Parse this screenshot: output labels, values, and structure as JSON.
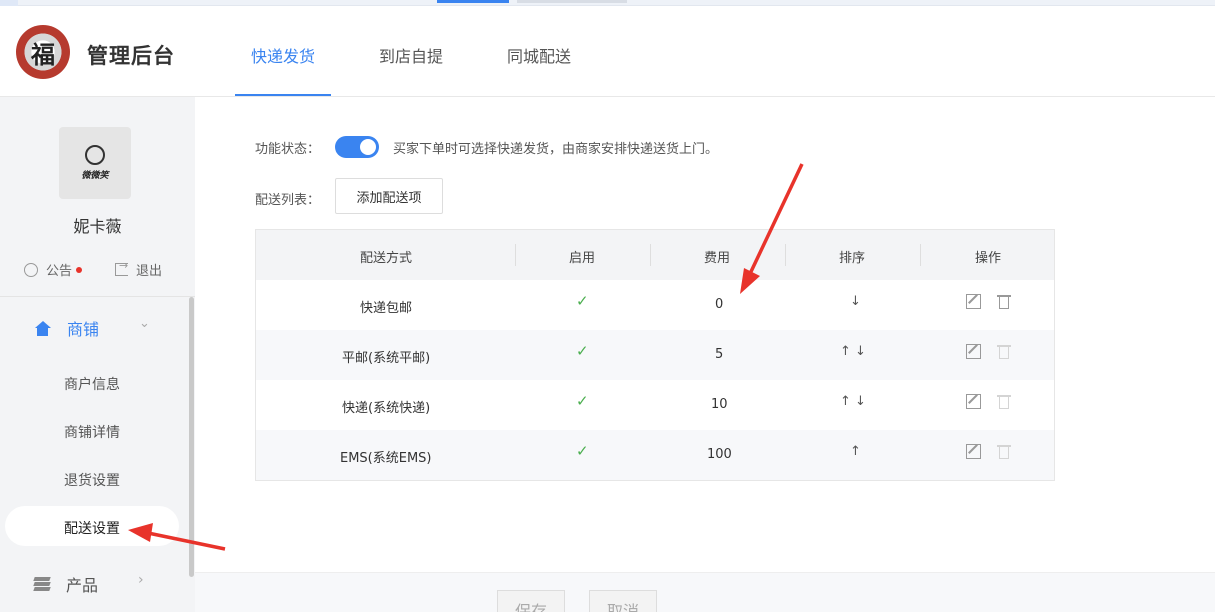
{
  "app": {
    "title": "管理后台",
    "logo_glyph": "福"
  },
  "user": {
    "avatar_brand": "微微笑",
    "name": "妮卡薇"
  },
  "sidebar": {
    "notice_label": "公告",
    "logout_label": "退出",
    "menu": [
      {
        "label": "商铺",
        "icon": "home-icon",
        "expanded": true
      },
      {
        "label": "产品",
        "icon": "layers-icon",
        "expanded": false
      }
    ],
    "sub_items": [
      "商户信息",
      "商铺详情",
      "退货设置",
      "配送设置"
    ],
    "active_sub": "配送设置"
  },
  "tabs": [
    {
      "label": "快递发货",
      "active": true
    },
    {
      "label": "到店自提",
      "active": false
    },
    {
      "label": "同城配送",
      "active": false
    }
  ],
  "settings": {
    "status_label": "功能状态：",
    "status_enabled": true,
    "status_desc": "买家下单时可选择快递发货，由商家安排快递送货上门。",
    "list_label": "配送列表：",
    "add_button": "添加配送项"
  },
  "table": {
    "headers": [
      "配送方式",
      "启用",
      "费用",
      "排序",
      "操作"
    ],
    "rows": [
      {
        "method": "快递包邮",
        "enabled": true,
        "fee": "0",
        "sort": "↓"
      },
      {
        "method": "平邮(系统平邮)",
        "enabled": true,
        "fee": "5",
        "sort": "↑ ↓"
      },
      {
        "method": "快递(系统快递)",
        "enabled": true,
        "fee": "10",
        "sort": "↑ ↓"
      },
      {
        "method": "EMS(系统EMS)",
        "enabled": true,
        "fee": "100",
        "sort": "↑"
      }
    ]
  },
  "footer": {
    "save_label": "保存",
    "cancel_label": "取消"
  },
  "colors": {
    "accent": "#3a84f0",
    "check": "#4caf50",
    "annotation": "#e8332b"
  }
}
